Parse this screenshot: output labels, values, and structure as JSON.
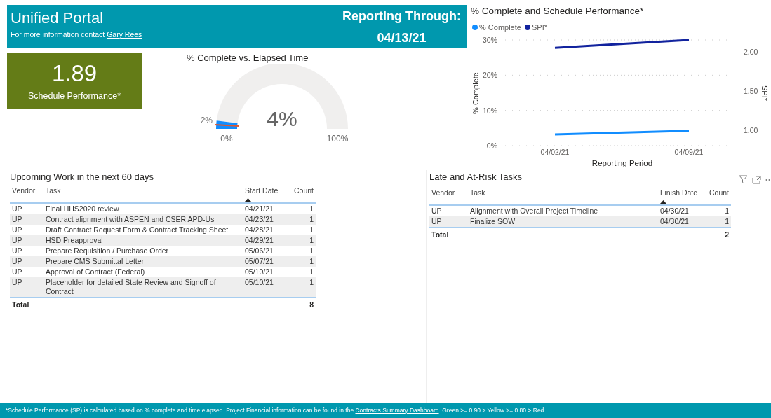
{
  "header": {
    "title": "Unified Portal",
    "contact_text": "For more information contact",
    "contact_link": "Gary Rees",
    "reporting_label": "Reporting Through:",
    "reporting_date": "04/13/21"
  },
  "kpi": {
    "value": "1.89",
    "label": "Schedule Performance*"
  },
  "gauge": {
    "title": "% Complete vs. Elapsed Time",
    "value_label": "4%",
    "target_label": "2%",
    "min_label": "0%",
    "max_label": "100%"
  },
  "trend": {
    "title": "% Complete and Schedule Performance*",
    "chart_data": {
      "type": "line",
      "legend": "top-left",
      "xlabel": "Reporting Period",
      "ylabel": "% Complete",
      "y2label": "SPI*",
      "x": [
        "04/02/21",
        "04/09/21"
      ],
      "series": [
        {
          "name": "% Complete",
          "color": "#118dff",
          "values": [
            3.2,
            4.2
          ]
        },
        {
          "name": "SPI*",
          "color": "#12239e",
          "axis": "y2",
          "values": [
            2.05,
            2.15
          ]
        }
      ],
      "ylim": [
        0,
        30
      ],
      "yticks": [
        {
          "value": 0,
          "label": "0%"
        },
        {
          "value": 10,
          "label": "10%"
        },
        {
          "value": 20,
          "label": "20%"
        },
        {
          "value": 30,
          "label": "30%"
        }
      ],
      "y2lim": [
        0.8,
        2.15
      ],
      "y2ticks": [
        {
          "value": 1,
          "label": "1.00"
        },
        {
          "value": 1.5,
          "label": "1.50"
        },
        {
          "value": 2,
          "label": "2.00"
        }
      ]
    }
  },
  "upcoming": {
    "title": "Upcoming Work in the next 60 days",
    "columns": [
      {
        "label": "Vendor",
        "sorted": false
      },
      {
        "label": "Task",
        "sorted": false
      },
      {
        "label": "Start Date",
        "sorted": true
      },
      {
        "label": "Count",
        "sorted": false
      }
    ],
    "rows": [
      [
        "UP",
        "Final HHS2020 review",
        "04/21/21",
        "1"
      ],
      [
        "UP",
        "Contract alignment with ASPEN and CSER APD-Us",
        "04/23/21",
        "1"
      ],
      [
        "UP",
        "Draft Contract Request Form & Contract Tracking Sheet",
        "04/28/21",
        "1"
      ],
      [
        "UP",
        "HSD Preapproval",
        "04/29/21",
        "1"
      ],
      [
        "UP",
        "Prepare Requisition / Purchase Order",
        "05/06/21",
        "1"
      ],
      [
        "UP",
        "Prepare CMS Submittal Letter",
        "05/07/21",
        "1"
      ],
      [
        "UP",
        "Approval of Contract (Federal)",
        "05/10/21",
        "1"
      ],
      [
        "UP",
        "Placeholder for detailed State Review and Signoff of Contract",
        "05/10/21",
        "1"
      ]
    ],
    "total_label": "Total",
    "total": "8"
  },
  "late": {
    "title": "Late and At-Risk Tasks",
    "columns": [
      {
        "label": "Vendor",
        "sorted": false
      },
      {
        "label": "Task",
        "sorted": false
      },
      {
        "label": "Finish Date",
        "sorted": true
      },
      {
        "label": "Count",
        "sorted": false
      }
    ],
    "rows": [
      [
        "UP",
        "Alignment with Overall Project Timeline",
        "04/30/21",
        "1"
      ],
      [
        "UP",
        "Finalize SOW",
        "04/30/21",
        "1"
      ]
    ],
    "total_label": "Total",
    "total": "2"
  },
  "footer": {
    "text_before": "*Schedule Performance (SP) is calculated based on % complete and time elapsed. Project Financial information can be found in the",
    "link": "Contracts Summary Dashboard",
    "text_after": ". Green >= 0.90 > Yellow >= 0.80 > Red"
  }
}
